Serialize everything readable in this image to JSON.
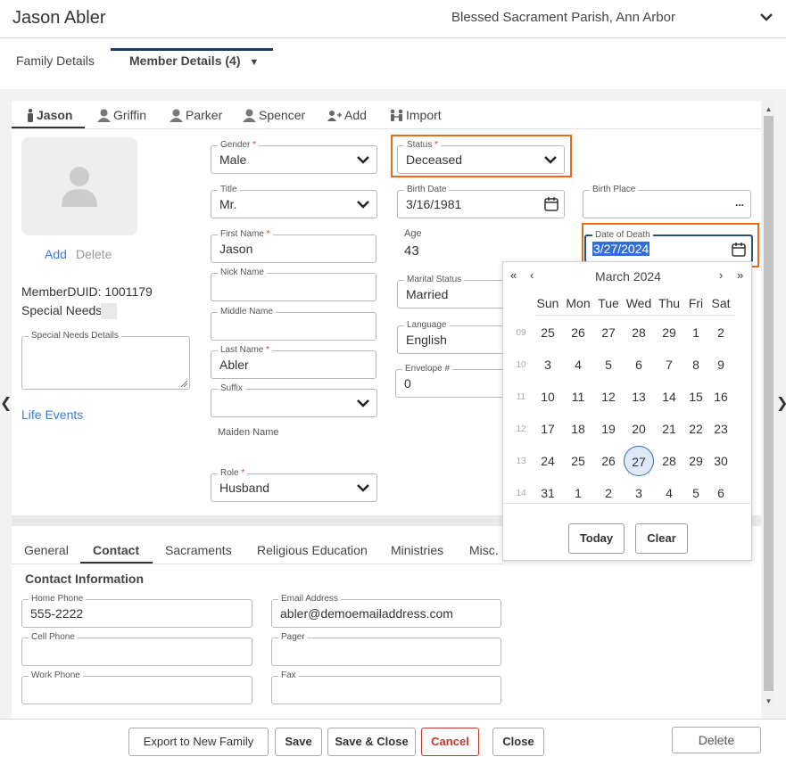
{
  "header": {
    "title": "Jason Abler",
    "parish": "Blessed Sacrament Parish, Ann Arbor"
  },
  "top_tabs": [
    {
      "label": "Family Details"
    },
    {
      "label": "Member Details (4)"
    }
  ],
  "member_tabs": [
    {
      "label": "Jason"
    },
    {
      "label": "Griffin"
    },
    {
      "label": "Parker"
    },
    {
      "label": "Spencer"
    },
    {
      "label": "Add"
    },
    {
      "label": "Import"
    }
  ],
  "photo": {
    "add_label": "Add",
    "delete_label": "Delete"
  },
  "member": {
    "duid_text": "MemberDUID: 1001179",
    "special_needs_label": "Special Needs",
    "special_needs_details_label": "Special Needs Details",
    "life_events_label": "Life Events"
  },
  "fields": {
    "gender": {
      "label": "Gender",
      "value": "Male"
    },
    "title": {
      "label": "Title",
      "value": "Mr."
    },
    "first_name": {
      "label": "First Name",
      "value": "Jason"
    },
    "nick_name": {
      "label": "Nick Name",
      "value": ""
    },
    "middle_name": {
      "label": "Middle Name",
      "value": ""
    },
    "last_name": {
      "label": "Last Name",
      "value": "Abler"
    },
    "suffix": {
      "label": "Suffix",
      "value": ""
    },
    "maiden_name": {
      "label": "Maiden Name"
    },
    "role": {
      "label": "Role",
      "value": "Husband"
    },
    "status": {
      "label": "Status",
      "value": "Deceased"
    },
    "birth_date": {
      "label": "Birth Date",
      "value": "3/16/1981"
    },
    "age": {
      "label": "Age",
      "value": "43"
    },
    "marital_status": {
      "label": "Marital Status",
      "value": "Married"
    },
    "language": {
      "label": "Language",
      "value": "English"
    },
    "envelope": {
      "label": "Envelope #",
      "value": "0"
    },
    "birth_place": {
      "label": "Birth Place",
      "value": "",
      "more": "..."
    },
    "date_of_death": {
      "label": "Date of Death",
      "value": "3/27/2024"
    }
  },
  "required_marker": "*",
  "datepicker": {
    "month_label": "March 2024",
    "nav": {
      "prev_year": "«",
      "prev_month": "‹",
      "next_month": "›",
      "next_year": "»"
    },
    "days_of_week": [
      "Sun",
      "Mon",
      "Tue",
      "Wed",
      "Thu",
      "Fri",
      "Sat"
    ],
    "weeks": [
      {
        "num": "09",
        "days": [
          "25",
          "26",
          "27",
          "28",
          "29",
          "1",
          "2"
        ]
      },
      {
        "num": "10",
        "days": [
          "3",
          "4",
          "5",
          "6",
          "7",
          "8",
          "9"
        ]
      },
      {
        "num": "11",
        "days": [
          "10",
          "11",
          "12",
          "13",
          "14",
          "15",
          "16"
        ]
      },
      {
        "num": "12",
        "days": [
          "17",
          "18",
          "19",
          "20",
          "21",
          "22",
          "23"
        ]
      },
      {
        "num": "13",
        "days": [
          "24",
          "25",
          "26",
          "27",
          "28",
          "29",
          "30"
        ]
      },
      {
        "num": "14",
        "days": [
          "31",
          "1",
          "2",
          "3",
          "4",
          "5",
          "6"
        ]
      }
    ],
    "selected_day": "27",
    "today_label": "Today",
    "clear_label": "Clear"
  },
  "lower_tabs": [
    {
      "label": "General"
    },
    {
      "label": "Contact"
    },
    {
      "label": "Sacraments"
    },
    {
      "label": "Religious Education"
    },
    {
      "label": "Ministries"
    },
    {
      "label": "Misc."
    }
  ],
  "contact": {
    "section_title": "Contact Information",
    "home_phone": {
      "label": "Home Phone",
      "value": "555-2222"
    },
    "email": {
      "label": "Email Address",
      "value": "abler@demoemailaddress.com"
    },
    "cell_phone": {
      "label": "Cell Phone",
      "value": ""
    },
    "pager": {
      "label": "Pager",
      "value": ""
    },
    "work_phone": {
      "label": "Work Phone",
      "value": ""
    },
    "fax": {
      "label": "Fax",
      "value": ""
    }
  },
  "footer": {
    "export_label": "Export to New Family",
    "save_label": "Save",
    "save_close_label": "Save & Close",
    "cancel_label": "Cancel",
    "close_label": "Close",
    "delete_label": "Delete"
  },
  "colors": {
    "accent_orange": "#e36c1e",
    "link_blue": "#3a7bd5",
    "cancel_red": "#c0392b",
    "nav_underline": "#1e3a66"
  }
}
